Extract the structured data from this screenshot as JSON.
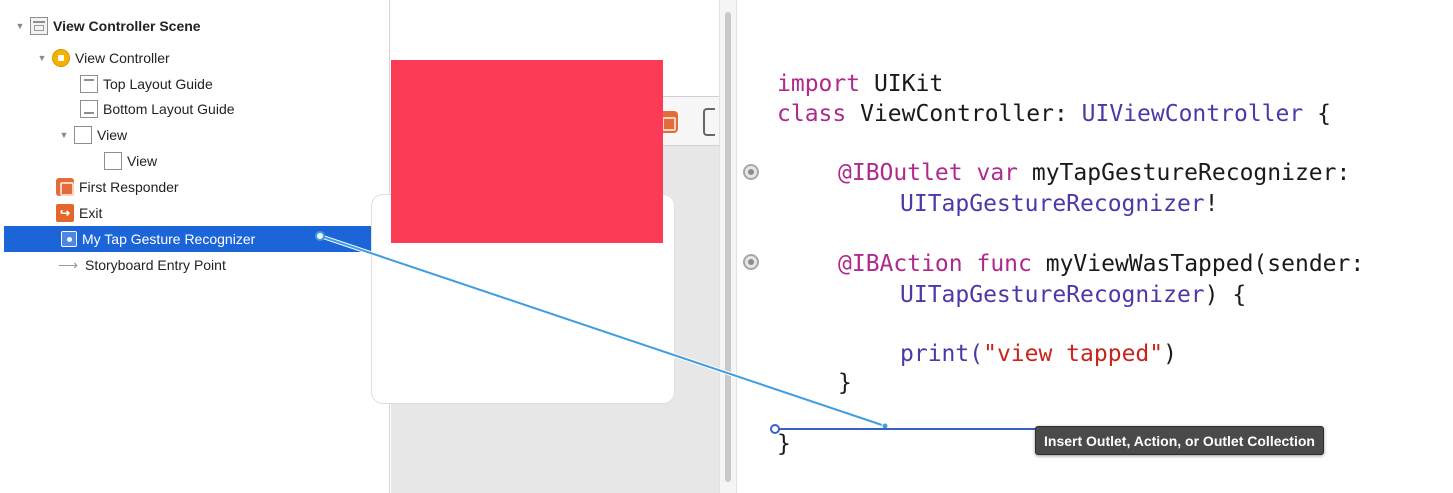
{
  "outline": {
    "items": [
      {
        "label": "View Controller Scene"
      },
      {
        "label": "View Controller"
      },
      {
        "label": "Top Layout Guide"
      },
      {
        "label": "Bottom Layout Guide"
      },
      {
        "label": "View"
      },
      {
        "label": "View"
      },
      {
        "label": "First Responder"
      },
      {
        "label": "Exit"
      },
      {
        "label": "My Tap Gesture Recognizer"
      },
      {
        "label": "Storyboard Entry Point"
      }
    ]
  },
  "canvas": {
    "view_color": "#fc3c56"
  },
  "editor": {
    "line1_kw": "import",
    "line1_rest": " UIKit",
    "line2_kw": "class",
    "line2_name": " ViewController: ",
    "line2_type": "UIViewController",
    "line2_end": " {",
    "outlet_attr": "@IBOutlet",
    "outlet_kw": " var",
    "outlet_name": " myTapGestureRecognizer:",
    "outlet_type": "UITapGestureRecognizer",
    "outlet_end": "!",
    "action_attr": "@IBAction",
    "action_kw": " func",
    "action_name": " myViewWasTapped(sender:",
    "action_type": "UITapGestureRecognizer",
    "action_end": ") {",
    "print_fn": "print(",
    "print_str": "\"view tapped\"",
    "print_end": ")",
    "close_inner": "}",
    "close_outer": "}"
  },
  "tooltip": {
    "text": "Insert Outlet, Action, or Outlet Collection"
  },
  "colors": {
    "selection": "#1c65d8",
    "connection_line": "#3f9ee0",
    "keyword": "#b02a8e",
    "type": "#4f37a8",
    "string": "#c9251c"
  }
}
